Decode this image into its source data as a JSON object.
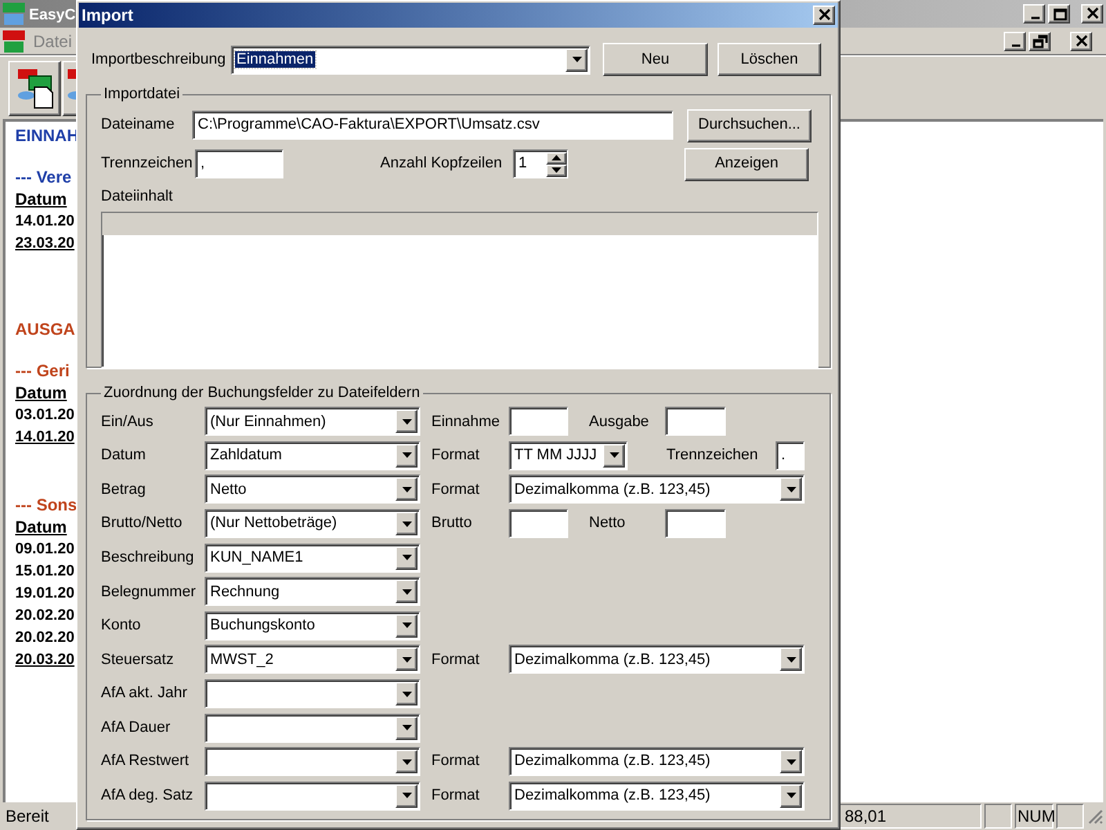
{
  "app": {
    "title": "EasyC",
    "menu": [
      {
        "label": "Datei",
        "disabled": true
      }
    ],
    "document": {
      "sections": [
        {
          "title": "EINNAH",
          "color": "#1f3fa8",
          "groups": [
            {
              "title": "--- Vere",
              "header": "Datum",
              "rows": [
                {
                  "text": "14.01.20",
                  "underlined": false
                },
                {
                  "text": "23.03.20",
                  "underlined": true
                }
              ]
            }
          ]
        },
        {
          "title": "AUSGA",
          "color": "#c0441c",
          "groups": [
            {
              "title": "--- Geri",
              "header": "Datum",
              "rows": [
                {
                  "text": "03.01.20",
                  "underlined": false
                },
                {
                  "text": "14.01.20",
                  "underlined": true
                }
              ]
            },
            {
              "title": "--- Sons",
              "header": "Datum",
              "rows": [
                {
                  "text": "09.01.20",
                  "underlined": false
                },
                {
                  "text": "15.01.20",
                  "underlined": false
                },
                {
                  "text": "19.01.20",
                  "underlined": false
                },
                {
                  "text": "20.02.20",
                  "underlined": false
                },
                {
                  "text": "20.02.20",
                  "underlined": false
                },
                {
                  "text": "20.03.20",
                  "underlined": true
                }
              ]
            }
          ]
        }
      ]
    },
    "status_bar": {
      "message": "Bereit",
      "value": "88,01",
      "indicators": [
        "NUM"
      ]
    }
  },
  "dialog": {
    "title": "Import",
    "description": {
      "label": "Importbeschreibung",
      "value": "Einnahmen",
      "focused": true
    },
    "buttons": [
      "Neu",
      "Löschen"
    ],
    "import_file": {
      "title": "Importdatei",
      "filename": {
        "label": "Dateiname",
        "value": "C:\\Programme\\CAO-Faktura\\EXPORT\\Umsatz.csv"
      },
      "browse_button": "Durchsuchen...",
      "separator": {
        "label": "Trennzeichen",
        "value": ","
      },
      "header_lines": {
        "label": "Anzahl Kopfzeilen",
        "value": "1"
      },
      "show_button": "Anzeigen",
      "content_label": "Dateiinhalt"
    },
    "mapping": {
      "title": "Zuordnung der Buchungsfelder zu Dateifeldern",
      "rows": [
        {
          "label": "Ein/Aus",
          "value": "(Nur Einnahmen)",
          "extra": {
            "kind": "pair",
            "fields": [
              {
                "label": "Einnahme"
              },
              {
                "label": "Ausgabe"
              }
            ]
          }
        },
        {
          "label": "Datum",
          "value": "Zahldatum",
          "extra": {
            "kind": "date_format",
            "label": "Format",
            "value": "TT MM JJJJ",
            "separator_label": "Trennzeichen",
            "separator_value": "."
          }
        },
        {
          "label": "Betrag",
          "value": "Netto",
          "extra": {
            "kind": "format",
            "label": "Format",
            "value": "Dezimalkomma (z.B. 123,45)"
          }
        },
        {
          "label": "Brutto/Netto",
          "value": "(Nur Nettobeträge)",
          "extra": {
            "kind": "pair",
            "fields": [
              {
                "label": "Brutto"
              },
              {
                "label": "Netto"
              }
            ]
          }
        },
        {
          "label": "Beschreibung",
          "value": "KUN_NAME1"
        },
        {
          "label": "Belegnummer",
          "value": "Rechnung"
        },
        {
          "label": "Konto",
          "value": "Buchungskonto"
        },
        {
          "label": "Steuersatz",
          "value": "MWST_2",
          "extra": {
            "kind": "format",
            "label": "Format",
            "value": "Dezimalkomma (z.B. 123,45)"
          }
        },
        {
          "label": "AfA akt. Jahr"
        },
        {
          "label": "AfA Dauer"
        },
        {
          "label": "AfA Restwert",
          "extra": {
            "kind": "format",
            "label": "Format",
            "value": "Dezimalkomma (z.B. 123,45)"
          }
        },
        {
          "label": "AfA deg. Satz",
          "extra": {
            "kind": "format",
            "label": "Format",
            "value": "Dezimalkomma (z.B. 123,45)"
          }
        }
      ]
    }
  }
}
